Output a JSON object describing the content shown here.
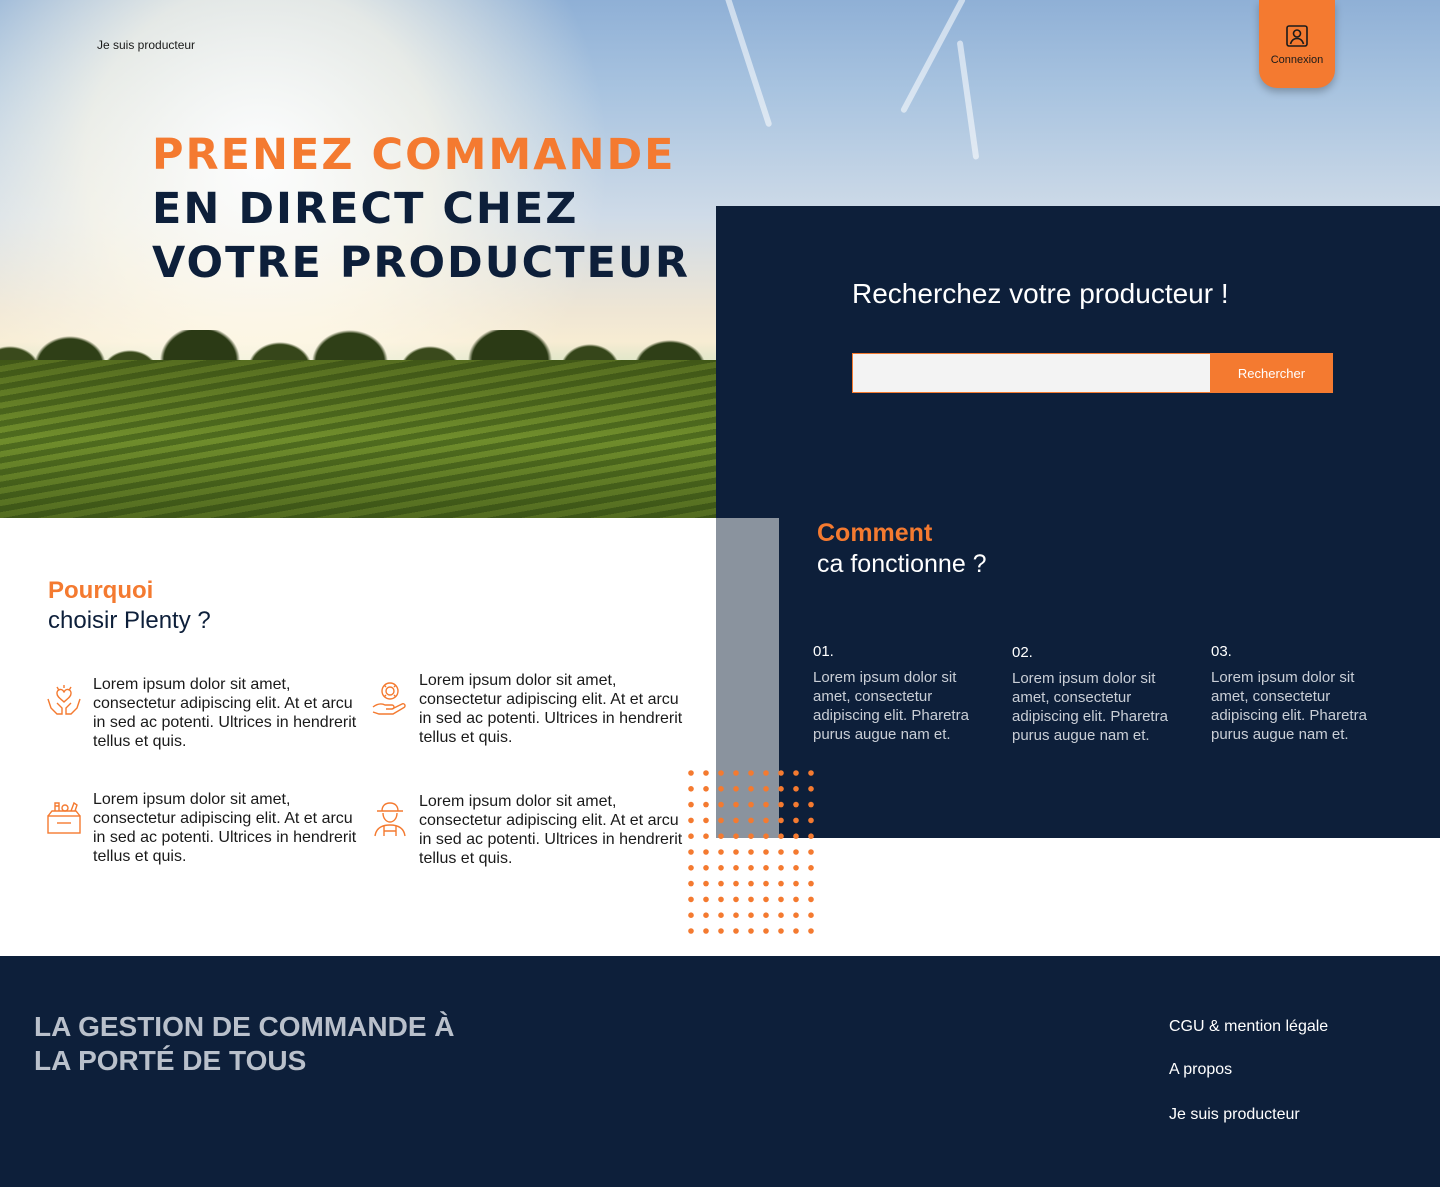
{
  "header": {
    "producer_link": "Je suis producteur",
    "login_label": "Connexion"
  },
  "hero": {
    "title_line1": "Prenez commande",
    "title_line2": "en direct chez",
    "title_line3": "votre producteur"
  },
  "search": {
    "title": "Recherchez votre producteur !",
    "button_label": "Rechercher",
    "input_value": ""
  },
  "how": {
    "title_accent": "Comment",
    "title_rest": "ca fonctionne ?",
    "steps": [
      {
        "num": "01.",
        "text": "Lorem ipsum dolor sit amet, consectetur adipiscing elit. Pharetra purus augue nam et."
      },
      {
        "num": "02.",
        "text": "Lorem ipsum dolor sit amet, consectetur adipiscing elit. Pharetra purus augue nam et."
      },
      {
        "num": "03.",
        "text": "Lorem ipsum dolor sit amet, consectetur adipiscing elit. Pharetra purus augue nam et."
      }
    ]
  },
  "why": {
    "title_accent": "Pourquoi",
    "title_rest": "choisir Plenty ?",
    "features": [
      {
        "icon": "heart-hands-icon",
        "text": "Lorem ipsum dolor sit amet, consectetur adipiscing elit. At et arcu in sed ac potenti. Ultrices in hendrerit tellus et quis."
      },
      {
        "icon": "flower-hand-icon",
        "text": "Lorem ipsum dolor sit amet, consectetur adipiscing elit. At et arcu in sed ac potenti. Ultrices in hendrerit tellus et quis."
      },
      {
        "icon": "produce-box-icon",
        "text": "Lorem ipsum dolor sit amet, consectetur adipiscing elit. At et arcu in sed ac potenti. Ultrices in hendrerit tellus et quis."
      },
      {
        "icon": "farmer-icon",
        "text": "Lorem ipsum dolor sit amet, consectetur adipiscing elit. At et arcu in sed ac potenti. Ultrices in hendrerit tellus et quis."
      }
    ]
  },
  "footer": {
    "tagline": "La gestion de commande à la porté de tous",
    "links": [
      "CGU & mention légale",
      "A propos",
      "Je suis producteur"
    ]
  },
  "colors": {
    "accent": "#f47a30",
    "navy": "#0d1f3a",
    "gray_bar": "#8a939e"
  }
}
